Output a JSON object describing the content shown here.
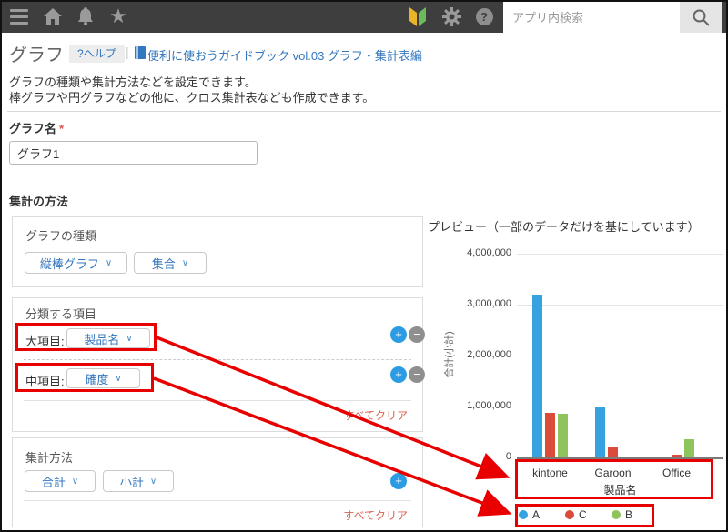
{
  "header": {
    "search_placeholder": "アプリ内検索"
  },
  "icons": {
    "star": "★",
    "question": "?",
    "chevron_down": "∨",
    "plus": "+",
    "minus": "−",
    "separator": "|"
  },
  "page": {
    "title": "グラフ",
    "help_button": "?ヘルプ",
    "guide_link": "便利に使おうガイドブック vol.03 グラフ・集計表編",
    "description_line1": "グラフの種類や集計方法などを設定できます。",
    "description_line2": "棒グラフや円グラフなどの他に、クロス集計表なども作成できます。"
  },
  "form": {
    "graph_name_label": "グラフ名",
    "required_mark": "*",
    "graph_name_value": "グラフ1",
    "aggregation_section_title": "集計の方法",
    "chart_type": {
      "label": "グラフの種類",
      "type_value": "縦棒グラフ",
      "mode_value": "集合"
    },
    "classify": {
      "label": "分類する項目",
      "rows": [
        {
          "label": "大項目:",
          "value": "製品名"
        },
        {
          "label": "中項目:",
          "value": "確度"
        }
      ],
      "clear_all": "すべてクリア"
    },
    "method": {
      "label": "集計方法",
      "func_value": "合計",
      "mode_value": "小計",
      "clear_all": "すべてクリア"
    }
  },
  "preview": {
    "title": "プレビュー（一部のデータだけを基にしています）"
  },
  "chart_data": {
    "type": "bar",
    "categories": [
      "kintone",
      "Garoon",
      "Office"
    ],
    "series": [
      {
        "name": "A",
        "color": "#36A2E0",
        "values": [
          3200000,
          1000000,
          0
        ]
      },
      {
        "name": "C",
        "color": "#DB4B3C",
        "values": [
          880000,
          200000,
          60000
        ]
      },
      {
        "name": "B",
        "color": "#8FC45C",
        "values": [
          850000,
          0,
          350000
        ]
      }
    ],
    "xlabel": "製品名",
    "ylabel": "合計(小計)",
    "ylim": [
      0,
      4000000
    ],
    "yticks": [
      {
        "value": 0,
        "label": "0"
      },
      {
        "value": 1000000,
        "label": "1,000,000"
      },
      {
        "value": 2000000,
        "label": "2,000,000"
      },
      {
        "value": 3000000,
        "label": "3,000,000"
      },
      {
        "value": 4000000,
        "label": "4,000,000"
      }
    ],
    "grid": true,
    "legend_position": "bottom"
  },
  "colors": {
    "topbar_bg": "#3E3E3E",
    "accent_blue": "#3576BE",
    "annotation_red": "#E80000",
    "clear_link_red": "#D9604F",
    "beginner_yellow": "#E9B32A",
    "beginner_green": "#6CBB5A"
  }
}
